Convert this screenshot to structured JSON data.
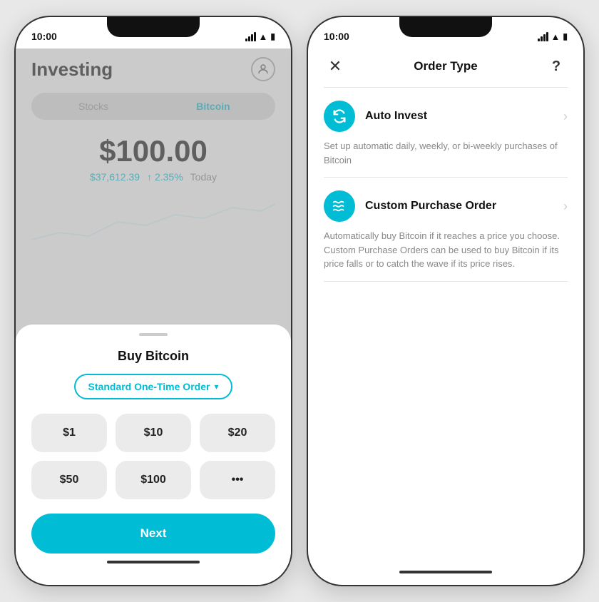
{
  "phone1": {
    "status": {
      "time": "10:00",
      "signal": "signal",
      "wifi": "wifi",
      "battery": "battery"
    },
    "header": {
      "title": "Investing",
      "profile_icon": "person"
    },
    "tabs": [
      {
        "label": "Stocks",
        "active": false
      },
      {
        "label": "Bitcoin",
        "active": true
      }
    ],
    "price": {
      "main": "$100.00",
      "btc": "$37,612.39",
      "change": "↑ 2.35%",
      "period": "Today"
    },
    "sheet": {
      "title": "Buy Bitcoin",
      "order_type": "Standard One-Time Order",
      "order_caret": "▾",
      "amounts": [
        "$1",
        "$10",
        "$20",
        "$50",
        "$100",
        "•••"
      ],
      "next_label": "Next"
    }
  },
  "phone2": {
    "status": {
      "time": "10:00"
    },
    "header": {
      "close": "✕",
      "title": "Order Type",
      "help": "?"
    },
    "options": [
      {
        "name": "Auto Invest",
        "icon": "↻",
        "description": "Set up automatic daily, weekly, or bi-weekly purchases of Bitcoin"
      },
      {
        "name": "Custom Purchase Order",
        "icon": "≋",
        "description": "Automatically buy Bitcoin if it reaches a price you choose. Custom Purchase Orders can be used to buy Bitcoin if its price falls or to catch the wave if its price rises."
      }
    ]
  }
}
